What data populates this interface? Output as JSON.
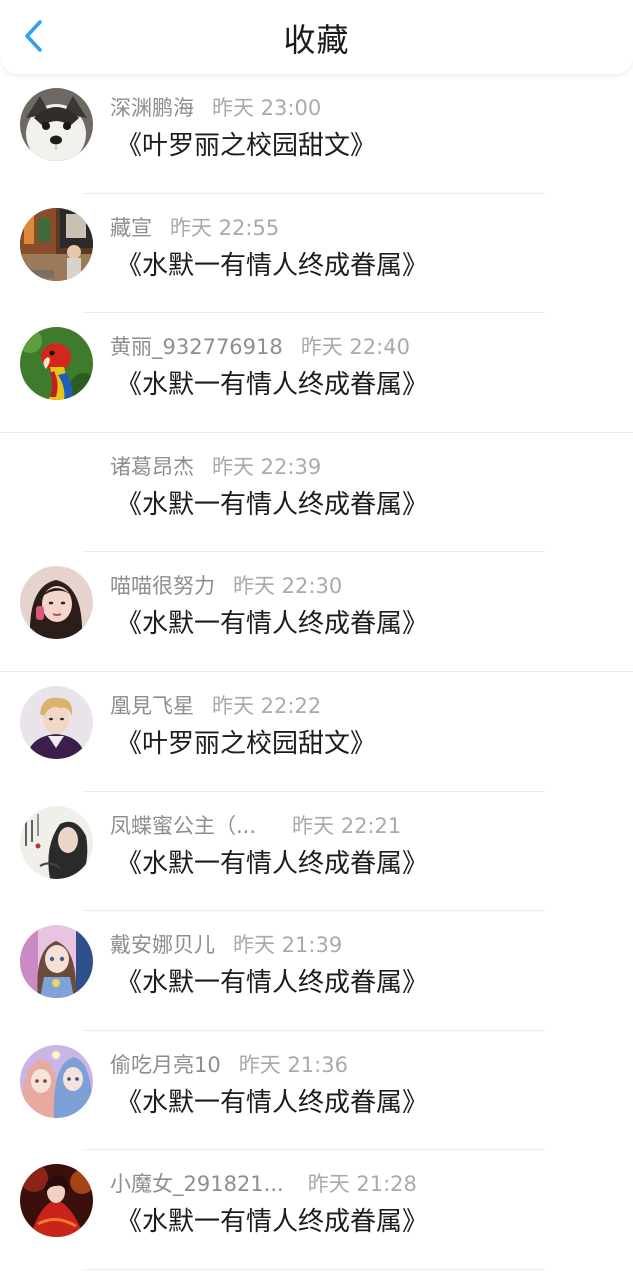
{
  "header": {
    "title": "收藏",
    "back_icon": "chevron-left-icon",
    "accent_color": "#2f9ef5"
  },
  "favorites": [
    {
      "user": "深渊鹏海",
      "time": "昨天 23:00",
      "title": "《叶罗丽之校园甜文》",
      "avatar": "husky-dog-avatar"
    },
    {
      "user": "藏宣",
      "time": "昨天 22:55",
      "title": "《水默一有情人终成眷属》",
      "avatar": "street-photo-avatar"
    },
    {
      "user": "黄丽_932776918",
      "time": "昨天 22:40",
      "title": "《水默一有情人终成眷属》",
      "avatar": "parrot-avatar"
    },
    {
      "user": "诸葛昂杰",
      "time": "昨天 22:39",
      "title": "《水默一有情人终成眷属》",
      "avatar": ""
    },
    {
      "user": "喵喵很努力",
      "time": "昨天 22:30",
      "title": "《水默一有情人终成眷属》",
      "avatar": "girl-portrait-avatar"
    },
    {
      "user": "凰見飞星",
      "time": "昨天 22:22",
      "title": "《叶罗丽之校园甜文》",
      "avatar": "boy-portrait-avatar"
    },
    {
      "user": "凤蝶蜜公主（...",
      "time": "昨天 22:21",
      "title": "《水默一有情人终成眷属》",
      "avatar": "ink-art-avatar"
    },
    {
      "user": "戴安娜贝儿",
      "time": "昨天 21:39",
      "title": "《水默一有情人终成眷属》",
      "avatar": "anime-girl-avatar"
    },
    {
      "user": "偷吃月亮10",
      "time": "昨天 21:36",
      "title": "《水默一有情人终成眷属》",
      "avatar": "anime-pair-avatar"
    },
    {
      "user": "小魔女_291821...",
      "time": "昨天 21:28",
      "title": "《水默一有情人终成眷属》",
      "avatar": "red-dress-avatar"
    }
  ]
}
